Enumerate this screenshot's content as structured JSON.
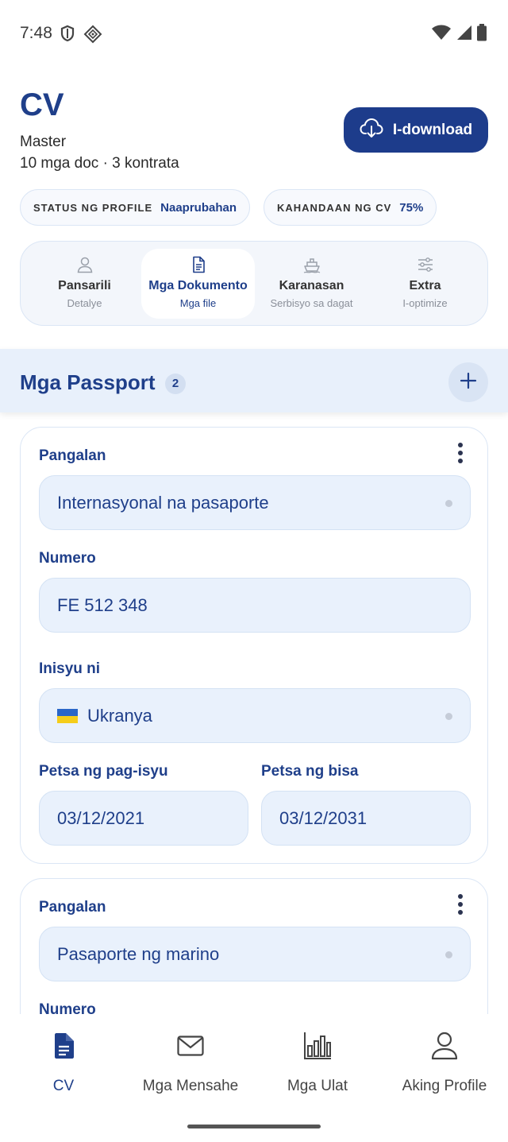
{
  "status_bar": {
    "time": "7:48"
  },
  "header": {
    "title": "CV",
    "subtitle": "Master",
    "meta": "10 mga doc · 3 kontrata",
    "download_label": "I-download"
  },
  "pills": [
    {
      "label": "STATUS NG PROFILE",
      "value": "Naaprubahan"
    },
    {
      "label": "KAHANDAAN NG CV",
      "value": "75%"
    }
  ],
  "tabs": [
    {
      "label": "Pansarili",
      "sub": "Detalye",
      "icon": "person-icon",
      "active": false
    },
    {
      "label": "Mga Dokumento",
      "sub": "Mga file",
      "icon": "document-icon",
      "active": true
    },
    {
      "label": "Karanasan",
      "sub": "Serbisyo sa dagat",
      "icon": "ship-icon",
      "active": false
    },
    {
      "label": "Extra",
      "sub": "I-optimize",
      "icon": "sliders-icon",
      "active": false
    }
  ],
  "section": {
    "title": "Mga Passport",
    "count": "2"
  },
  "cards": [
    {
      "name_label": "Pangalan",
      "name_value": "Internasyonal na pasaporte",
      "number_label": "Numero",
      "number_value": "FE 512 348",
      "issued_label": "Inisyu ni",
      "issued_value": "Ukranya",
      "issue_date_label": "Petsa ng pag-isyu",
      "issue_date_value": "03/12/2021",
      "expiry_label": "Petsa ng bisa",
      "expiry_value": "03/12/2031"
    },
    {
      "name_label": "Pangalan",
      "name_value": "Pasaporte ng marino",
      "number_label": "Numero"
    }
  ],
  "bottom_nav": [
    {
      "label": "CV",
      "icon": "cv-document-icon",
      "active": true
    },
    {
      "label": "Mga Mensahe",
      "icon": "mail-icon",
      "active": false
    },
    {
      "label": "Mga Ulat",
      "icon": "bar-chart-icon",
      "active": false
    },
    {
      "label": "Aking Profile",
      "icon": "profile-icon",
      "active": false
    }
  ],
  "colors": {
    "primary": "#1d3c8b",
    "accent_bg": "#e8f0fb",
    "field_bg": "#e9f1fc"
  }
}
